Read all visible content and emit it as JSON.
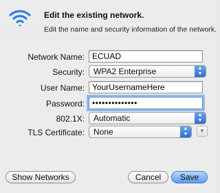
{
  "dialog": {
    "title": "Edit the existing network.",
    "subtitle": "Edit the name and security information of the network."
  },
  "form": {
    "network_name_label": "Network Name:",
    "network_name_value": "ECUAD",
    "security_label": "Security:",
    "security_value": "WPA2 Enterprise",
    "username_label": "User Name:",
    "username_value": "YourUsernameHere",
    "password_label": "Password:",
    "password_value": "••••••••••••••",
    "dot1x_label": "802.1X:",
    "dot1x_value": "Automatic",
    "tls_label": "TLS Certificate:",
    "tls_value": "None"
  },
  "buttons": {
    "show_networks": "Show Networks",
    "cancel": "Cancel",
    "save": "Save"
  },
  "icons": {
    "header": "wifi-icon",
    "select_arrow": "updown-arrows-icon"
  },
  "colors": {
    "accent": "#3b82e0",
    "focus_ring": "#5b8fd1"
  }
}
